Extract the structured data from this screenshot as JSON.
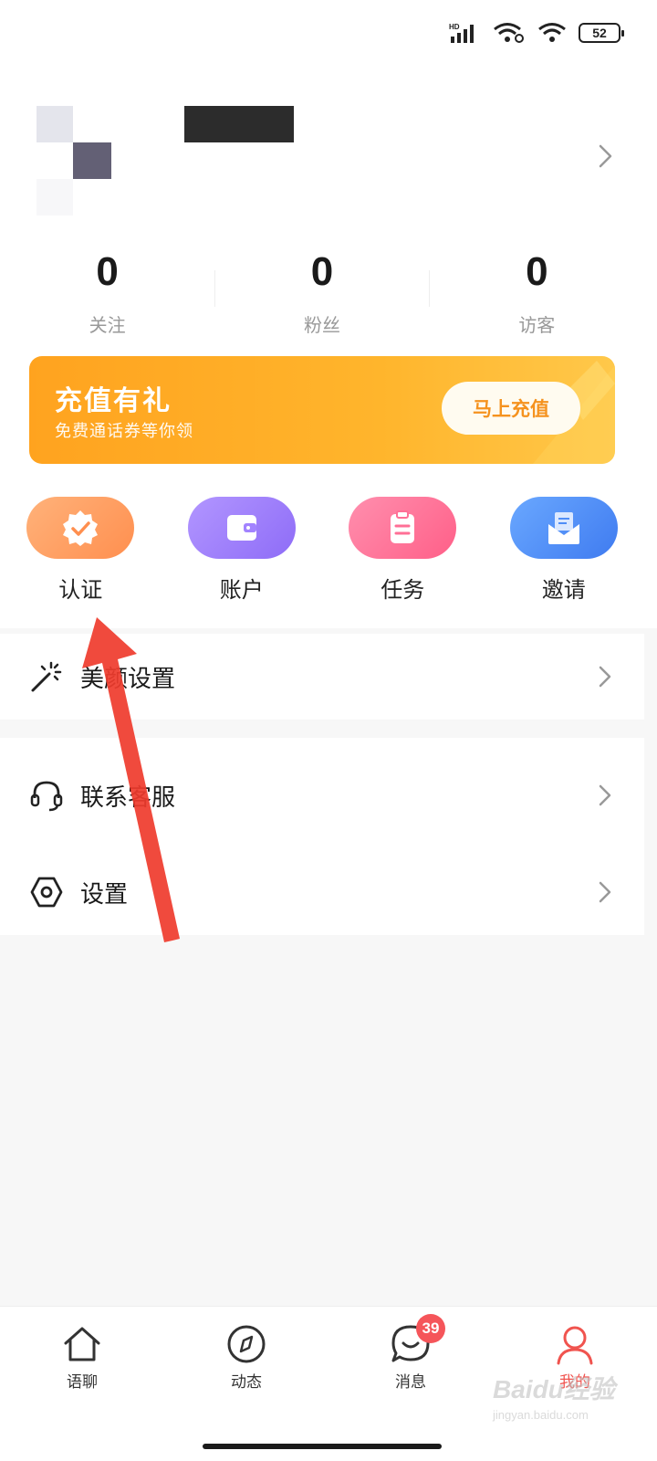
{
  "status_bar": {
    "network": "HD",
    "battery": "52"
  },
  "profile": {
    "name": "",
    "tag": ""
  },
  "stats": [
    {
      "value": "0",
      "label": "关注"
    },
    {
      "value": "0",
      "label": "粉丝"
    },
    {
      "value": "0",
      "label": "访客"
    }
  ],
  "banner": {
    "title": "充值有礼",
    "subtitle": "免费通话券等你领",
    "button": "马上充值"
  },
  "quick_actions": [
    {
      "label": "认证",
      "icon": "verified-badge-icon",
      "color": "#ff9a5c"
    },
    {
      "label": "账户",
      "icon": "wallet-icon",
      "color": "#9b7bff"
    },
    {
      "label": "任务",
      "icon": "clipboard-icon",
      "color": "#ff6f96"
    },
    {
      "label": "邀请",
      "icon": "envelope-icon",
      "color": "#4f8df7"
    }
  ],
  "menu": {
    "beauty": "美颜设置",
    "support": "联系客服",
    "settings": "设置"
  },
  "bottom_nav": [
    {
      "label": "语聊",
      "icon": "home-icon"
    },
    {
      "label": "动态",
      "icon": "compass-icon"
    },
    {
      "label": "消息",
      "icon": "chat-icon",
      "badge": "39"
    },
    {
      "label": "我的",
      "icon": "person-icon",
      "active": true
    }
  ],
  "watermark": {
    "brand": "Baidu经验",
    "url": "jingyan.baidu.com"
  }
}
